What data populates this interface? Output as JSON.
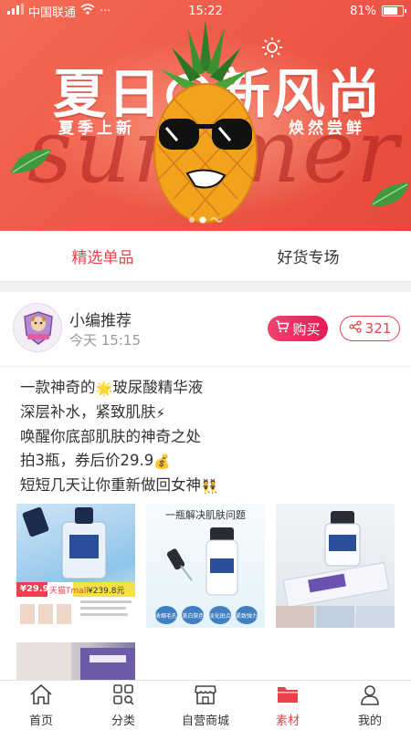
{
  "status_bar": {
    "carrier": "中国联通",
    "dots": "···",
    "time": "15:22",
    "battery": "81%",
    "battery_level": 0.81
  },
  "banner": {
    "title": "夏日の新风尚",
    "script_text": "summer",
    "subtitle_left": "夏季上新",
    "subtitle_right": "焕然尝鲜"
  },
  "tabs": [
    {
      "label": "精选单品",
      "active": true
    },
    {
      "label": "好货专场",
      "active": false
    }
  ],
  "post": {
    "author": "小编推荐",
    "time": "今天 15:15",
    "buy_label": "购买",
    "share_count": "321",
    "lines": [
      {
        "before": "一款神奇的",
        "emoji": "🌟",
        "after": "玻尿酸精华液"
      },
      {
        "before": "深层补水，紧致肌肤",
        "emoji": "⚡",
        "after": ""
      },
      {
        "before": "唤醒你底部肌肤的神奇之处",
        "emoji": "",
        "after": ""
      },
      {
        "before": "拍3瓶，券后价29.9",
        "emoji": "💰",
        "after": ""
      },
      {
        "before": "短短几天让你重新做回女神",
        "emoji": "👯",
        "after": ""
      }
    ],
    "photos": {
      "p1": {
        "price": "¥29.9",
        "store": "天猫Tmall",
        "coupon": "¥239.8元"
      },
      "p2": {
        "headline": "一瓶解决肌肤问题",
        "tags": [
          "收缩毛孔",
          "美白肤色",
          "淡化斑点",
          "紧致弹力"
        ]
      }
    }
  },
  "bottom_nav": [
    {
      "label": "首页",
      "icon": "home-icon",
      "active": false
    },
    {
      "label": "分类",
      "icon": "category-icon",
      "active": false
    },
    {
      "label": "自营商城",
      "icon": "store-icon",
      "active": false
    },
    {
      "label": "素材",
      "icon": "folder-icon",
      "active": true
    },
    {
      "label": "我的",
      "icon": "user-icon",
      "active": false
    }
  ],
  "colors": {
    "accent": "#e8434b",
    "buy_gradient_start": "#f0436e",
    "buy_gradient_end": "#e61c5a",
    "banner": "#ef5b4a"
  }
}
